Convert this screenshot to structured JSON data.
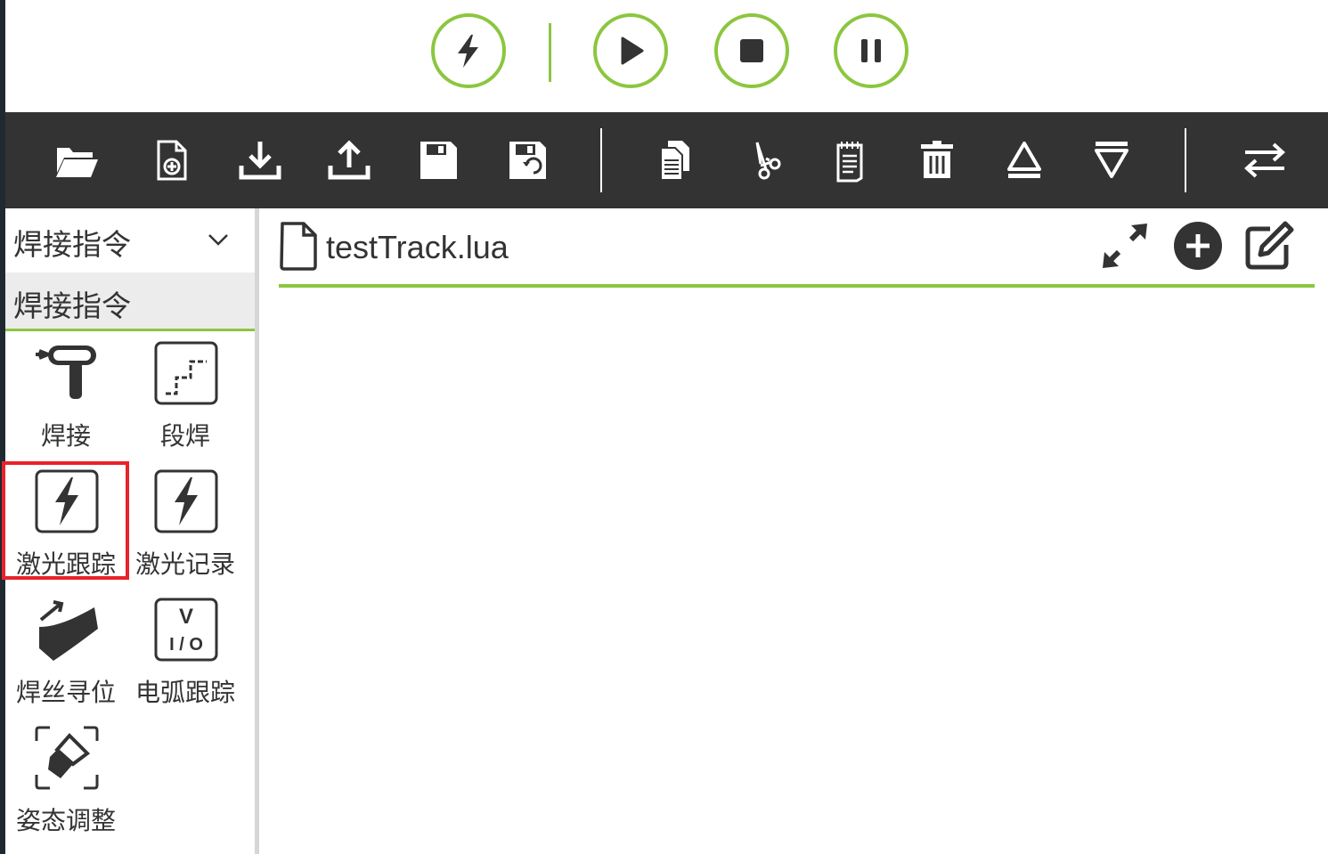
{
  "controls": {
    "items": [
      {
        "name": "power-icon"
      },
      {
        "name": "play-icon"
      },
      {
        "name": "stop-icon"
      },
      {
        "name": "pause-icon"
      }
    ],
    "accent_color": "#8cc63f"
  },
  "toolbar": {
    "background": "#333333",
    "items": [
      {
        "name": "open-folder-icon"
      },
      {
        "name": "new-file-icon"
      },
      {
        "name": "download-icon"
      },
      {
        "name": "upload-icon"
      },
      {
        "name": "save-icon"
      },
      {
        "name": "save-as-icon"
      },
      {
        "name": "copy-icon"
      },
      {
        "name": "cut-icon"
      },
      {
        "name": "paste-icon"
      },
      {
        "name": "delete-icon"
      },
      {
        "name": "move-up-icon"
      },
      {
        "name": "move-down-icon"
      },
      {
        "name": "switch-icon"
      }
    ]
  },
  "sidebar": {
    "category_dropdown": "焊接指令",
    "category_selected": "焊接指令",
    "tools": [
      {
        "label": "焊接",
        "icon": "weld-torch-icon"
      },
      {
        "label": "段焊",
        "icon": "segment-weld-icon"
      },
      {
        "label": "激光跟踪",
        "icon": "laser-track-icon",
        "highlighted": true
      },
      {
        "label": "激光记录",
        "icon": "laser-record-icon"
      },
      {
        "label": "焊丝寻位",
        "icon": "wire-search-icon"
      },
      {
        "label": "电弧跟踪",
        "icon": "arc-track-icon"
      },
      {
        "label": "姿态调整",
        "icon": "pose-adjust-icon"
      }
    ],
    "highlight_color": "#e8232a"
  },
  "editor": {
    "filename": "testTrack.lua",
    "actions": [
      {
        "name": "expand-icon"
      },
      {
        "name": "add-circle-icon"
      },
      {
        "name": "edit-icon"
      }
    ]
  },
  "arc_icon_text": {
    "top": "V",
    "bottom": "I / O"
  }
}
